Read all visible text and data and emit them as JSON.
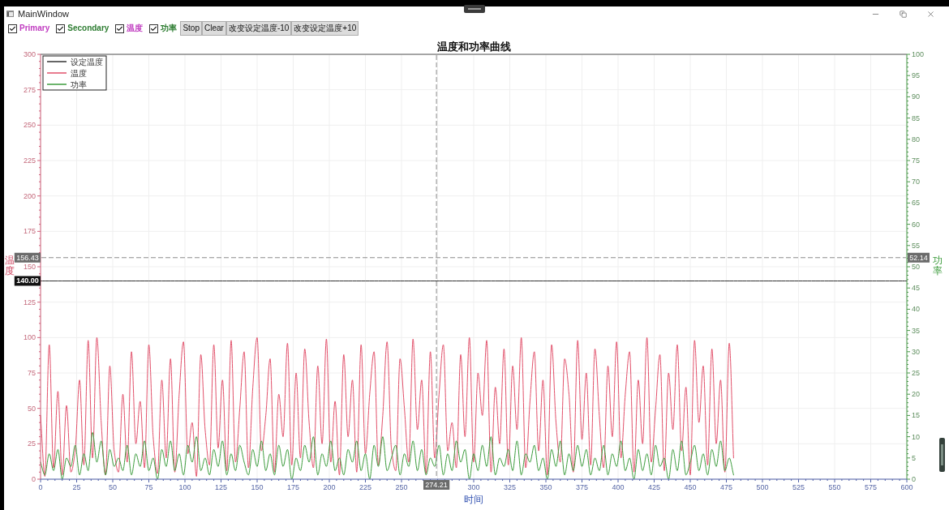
{
  "window": {
    "title": "MainWindow"
  },
  "toolbar": {
    "checkboxes": [
      {
        "label": "Primary",
        "checked": true,
        "color": "#c03cc0"
      },
      {
        "label": "Secondary",
        "checked": true,
        "color": "#2e7d32"
      },
      {
        "label": "温度",
        "checked": true,
        "color": "#c03cc0"
      },
      {
        "label": "功率",
        "checked": true,
        "color": "#2e7d32"
      }
    ],
    "buttons": [
      {
        "label": "Stop"
      },
      {
        "label": "Clear"
      },
      {
        "label": "改变设定温度-10"
      },
      {
        "label": "改变设定温度+10"
      }
    ]
  },
  "chart": {
    "chart_data": {
      "type": "line",
      "title": "温度和功率曲线",
      "xlabel": "时间",
      "ylabel": "温度",
      "y2label": "功率",
      "xlim": [
        0,
        600
      ],
      "ylim": [
        0,
        300
      ],
      "y2lim": [
        0,
        100
      ],
      "grid": true,
      "legend": "upper left",
      "xticks": [
        0,
        25,
        50,
        75,
        100,
        125,
        150,
        175,
        200,
        225,
        250,
        300,
        325,
        350,
        375,
        400,
        425,
        450,
        475,
        500,
        525,
        550,
        575,
        600
      ],
      "yticks": [
        0,
        25,
        50,
        75,
        100,
        125,
        150,
        175,
        200,
        225,
        250,
        275,
        300
      ],
      "y2ticks": [
        0,
        5,
        10,
        15,
        20,
        25,
        30,
        35,
        40,
        45,
        50,
        55,
        60,
        65,
        70,
        75,
        80,
        85,
        90,
        95,
        100
      ],
      "x": [
        0,
        3,
        6,
        9,
        12,
        15,
        18,
        21,
        24,
        27,
        30,
        33,
        36,
        39,
        42,
        45,
        48,
        51,
        54,
        57,
        60,
        63,
        66,
        69,
        72,
        75,
        78,
        81,
        84,
        87,
        90,
        93,
        96,
        99,
        102,
        105,
        108,
        111,
        114,
        117,
        120,
        123,
        126,
        129,
        132,
        135,
        138,
        141,
        144,
        147,
        150,
        153,
        156,
        159,
        162,
        165,
        168,
        171,
        174,
        177,
        180,
        183,
        186,
        189,
        192,
        195,
        198,
        201,
        204,
        207,
        210,
        213,
        216,
        219,
        222,
        225,
        228,
        231,
        234,
        237,
        240,
        243,
        246,
        249,
        252,
        255,
        258,
        261,
        264,
        267,
        270,
        273,
        276,
        279,
        282,
        285,
        288,
        291,
        294,
        297,
        300,
        303,
        306,
        309,
        312,
        315,
        318,
        321,
        324,
        327,
        330,
        333,
        336,
        339,
        342,
        345,
        348,
        351,
        354,
        357,
        360,
        363,
        366,
        369,
        372,
        375,
        378,
        381,
        384,
        387,
        390,
        393,
        396,
        399,
        402,
        405,
        408,
        411,
        414,
        417,
        420,
        423,
        426,
        429,
        432,
        435,
        438,
        441,
        444,
        447,
        450,
        453,
        456,
        459,
        462,
        465,
        468,
        471,
        474,
        477,
        480,
        483,
        486,
        489,
        492,
        495,
        498,
        501,
        504,
        507,
        510,
        513,
        516,
        519,
        522,
        525,
        528,
        531,
        534,
        537,
        540,
        543,
        546,
        549,
        552,
        555,
        558,
        561,
        564,
        567,
        570,
        573,
        576,
        579,
        582,
        585,
        588,
        591,
        594,
        597,
        600
      ],
      "series": [
        {
          "name": "设定温度",
          "color": "#333333",
          "values": [
            140,
            140,
            140,
            140,
            140,
            140,
            140,
            140,
            140,
            140,
            140,
            140,
            140,
            140,
            140,
            140,
            140,
            140,
            140,
            140,
            140,
            140,
            140,
            140,
            140,
            140,
            140,
            140,
            140,
            140,
            140,
            140,
            140,
            140,
            140,
            140,
            140,
            140,
            140,
            140,
            140,
            140,
            140,
            140,
            140,
            140,
            140,
            140,
            140,
            140,
            140,
            140,
            140,
            140,
            140,
            140,
            140,
            140,
            140,
            140,
            140,
            140,
            140,
            140,
            140,
            140,
            140,
            140,
            140,
            140,
            140,
            140,
            140,
            140,
            140,
            140,
            140,
            140,
            140,
            140,
            140,
            140,
            140,
            140,
            140,
            140,
            140,
            140,
            140,
            140,
            140,
            140,
            140,
            140,
            140,
            140,
            140,
            140,
            140,
            140,
            140,
            140,
            140,
            140,
            140,
            140,
            140,
            140,
            140,
            140,
            140,
            140,
            140,
            140,
            140,
            140,
            140,
            140,
            140,
            140,
            140,
            140,
            140,
            140,
            140,
            140,
            140,
            140,
            140,
            140,
            140,
            140,
            140,
            140,
            140,
            140,
            140,
            140,
            140,
            140,
            140,
            140,
            140,
            140,
            140,
            140,
            140,
            140,
            140,
            140,
            140,
            140,
            140,
            140,
            140,
            140,
            140,
            140,
            140,
            140,
            140,
            140,
            140,
            140,
            140,
            140,
            140,
            140,
            140,
            140,
            140,
            140,
            140,
            140,
            140,
            140,
            140,
            140,
            140,
            140,
            140,
            140,
            140,
            140,
            140,
            140,
            140,
            140,
            140,
            140,
            140,
            140,
            140,
            140,
            140,
            140,
            140,
            140,
            140,
            140,
            140
          ]
        },
        {
          "name": "温度",
          "color": "#e2506a",
          "values": [
            45,
            2,
            95,
            8,
            62,
            3,
            52,
            5,
            20,
            70,
            10,
            98,
            15,
            100,
            40,
            3,
            80,
            20,
            5,
            60,
            12,
            90,
            25,
            55,
            8,
            95,
            30,
            4,
            70,
            15,
            85,
            5,
            60,
            97,
            18,
            40,
            2,
            88,
            35,
            10,
            95,
            22,
            70,
            6,
            98,
            12,
            50,
            90,
            8,
            65,
            100,
            20,
            45,
            85,
            5,
            60,
            30,
            96,
            10,
            75,
            15,
            92,
            40,
            8,
            80,
            25,
            99,
            12,
            55,
            3,
            88,
            30,
            70,
            5,
            95,
            18,
            60,
            90,
            10,
            45,
            97,
            22,
            6,
            85,
            50,
            12,
            99,
            35,
            70,
            4,
            90,
            15,
            60,
            95,
            20,
            40,
            8,
            88,
            30,
            100,
            12,
            75,
            45,
            98,
            5,
            65,
            25,
            92,
            10,
            80,
            35,
            100,
            8,
            55,
            90,
            20,
            70,
            3,
            95,
            40,
            12,
            85,
            60,
            5,
            98,
            28,
            75,
            10,
            92,
            45,
            8,
            80,
            30,
            97,
            15,
            60,
            90,
            5,
            70,
            25,
            100,
            12,
            50,
            88,
            6,
            75,
            35,
            95,
            20,
            65,
            3,
            98,
            40,
            80,
            10,
            92,
            25,
            70,
            5,
            96,
            15,
            null,
            null,
            null,
            null,
            null,
            null,
            null,
            null,
            null,
            null,
            null,
            null,
            null,
            null,
            null,
            null,
            null,
            null,
            null,
            null,
            null,
            null,
            null,
            null,
            null,
            null,
            null,
            null,
            null,
            null,
            null,
            null,
            null,
            null,
            null,
            null,
            null,
            null,
            null,
            null
          ]
        },
        {
          "name": "功率",
          "color": "#3c9c3c",
          "axis": "y2",
          "values": [
            4,
            1,
            6,
            2,
            7,
            0,
            5,
            3,
            8,
            1,
            6,
            2,
            11,
            4,
            9,
            1,
            7,
            3,
            5,
            2,
            8,
            1,
            6,
            3,
            9,
            2,
            5,
            0,
            7,
            3,
            9,
            2,
            6,
            1,
            8,
            4,
            10,
            2,
            5,
            1,
            7,
            3,
            9,
            1,
            6,
            2,
            8,
            4,
            1,
            7,
            3,
            9,
            2,
            6,
            1,
            8,
            3,
            7,
            0,
            5,
            2,
            8,
            4,
            10,
            1,
            6,
            3,
            9,
            2,
            5,
            1,
            7,
            4,
            9,
            2,
            6,
            0,
            8,
            3,
            10,
            2,
            5,
            8,
            1,
            6,
            3,
            9,
            2,
            7,
            1,
            5,
            3,
            8,
            1,
            6,
            2,
            9,
            4,
            7,
            0,
            6,
            2,
            8,
            3,
            10,
            1,
            5,
            3,
            7,
            2,
            9,
            1,
            6,
            4,
            8,
            2,
            5,
            0,
            7,
            3,
            9,
            1,
            6,
            2,
            8,
            3,
            7,
            1,
            5,
            2,
            8,
            1,
            6,
            3,
            9,
            2,
            5,
            0,
            7,
            2,
            6,
            1,
            8,
            3,
            5,
            0,
            7,
            2,
            9,
            1,
            4,
            8,
            2,
            6,
            1,
            7,
            3,
            9,
            2,
            5,
            1,
            null,
            null,
            null,
            null,
            null,
            null,
            null,
            null,
            null,
            null,
            null,
            null,
            null,
            null,
            null,
            null,
            null,
            null,
            null,
            null,
            null,
            null,
            null,
            null,
            null,
            null,
            null,
            null,
            null,
            null,
            null,
            null,
            null,
            null,
            null,
            null,
            null,
            null,
            null,
            null
          ]
        }
      ],
      "ref_lines": [
        {
          "axis": "x",
          "value": 274.21,
          "label": "274.21"
        },
        {
          "axis": "y",
          "value": 156.43,
          "label": "156.43"
        },
        {
          "axis": "y2",
          "value": 52.14,
          "label": "52.14"
        }
      ],
      "annotations": [
        {
          "text": "140.00",
          "y": 140
        }
      ]
    }
  }
}
